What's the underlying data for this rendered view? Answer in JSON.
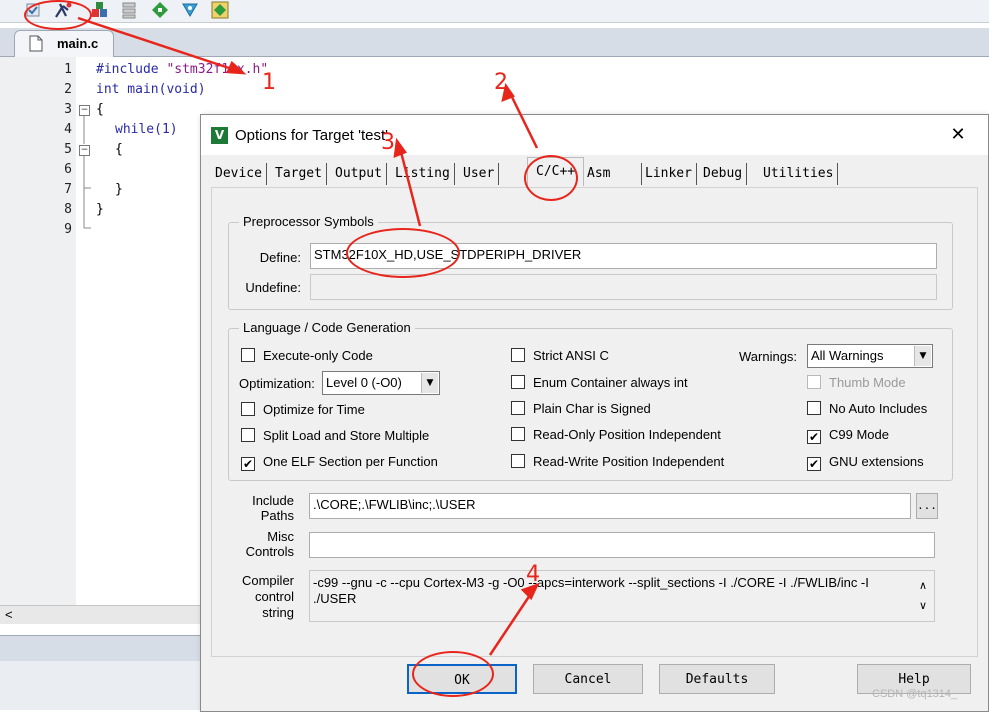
{
  "ide": {
    "editor_tab": "main.c",
    "line_numbers": [
      "1",
      "2",
      "3",
      "4",
      "5",
      "6",
      "7",
      "8",
      "9"
    ],
    "code": {
      "line1_kw": "#include",
      "line1_str": "\"stm32f10x.h\"",
      "line2": "int main(void)",
      "line3": "{",
      "line4": "while(1)",
      "line5": "{",
      "line7": "}",
      "line8": "}"
    },
    "scroll_left": "<"
  },
  "dialog": {
    "title": "Options for Target 'test'",
    "close": "✕",
    "icon_letter": "V",
    "tabs": [
      "Device",
      "Target",
      "Output",
      "Listing",
      "User",
      "C/C++",
      "Asm",
      "Linker",
      "Debug",
      "Utilities"
    ],
    "active_tab": "C/C++",
    "preprocessor": {
      "group_title": "Preprocessor Symbols",
      "define_label": "Define:",
      "define_value": "STM32F10X_HD,USE_STDPERIPH_DRIVER",
      "undefine_label": "Undefine:",
      "undefine_value": ""
    },
    "language": {
      "group_title": "Language / Code Generation",
      "execute_only": "Execute-only Code",
      "optimization_label": "Optimization:",
      "optimization_value": "Level 0 (-O0)",
      "optimize_time": "Optimize for Time",
      "split_load": "Split Load and Store Multiple",
      "one_elf": "One ELF Section per Function",
      "strict_ansi": "Strict ANSI C",
      "enum_container": "Enum Container always int",
      "plain_char": "Plain Char is Signed",
      "ro_pos_indep": "Read-Only Position Independent",
      "rw_pos_indep": "Read-Write Position Independent",
      "warnings_label": "Warnings:",
      "warnings_value": "All Warnings",
      "thumb_mode": "Thumb Mode",
      "no_auto_includes": "No Auto Includes",
      "c99_mode": "C99 Mode",
      "gnu_extensions": "GNU extensions",
      "checked": {
        "one_elf": true,
        "c99_mode": true,
        "gnu_extensions": true
      }
    },
    "include_paths_label": "Include\nPaths",
    "include_paths_value": ".\\CORE;.\\FWLIB\\inc;.\\USER",
    "browse": "...",
    "misc_label": "Misc\nControls",
    "misc_value": "",
    "compiler_label": "Compiler\ncontrol\nstring",
    "compiler_value_line1": "-c99 --gnu -c --cpu Cortex-M3 -g -O0 --apcs=interwork --split_sections -I ./CORE -I ./FWLIB/inc -I",
    "compiler_value_line2": "./USER",
    "buttons": {
      "ok": "OK",
      "cancel": "Cancel",
      "defaults": "Defaults",
      "help": "Help"
    }
  },
  "annotations": [
    "1",
    "2",
    "3",
    "4"
  ],
  "watermark": "CSDN @tq1314_",
  "colors": {
    "annotation_red": "#e8251b",
    "keyword_blue": "#2a2aa8",
    "string_purple": "#8b1a8b"
  }
}
